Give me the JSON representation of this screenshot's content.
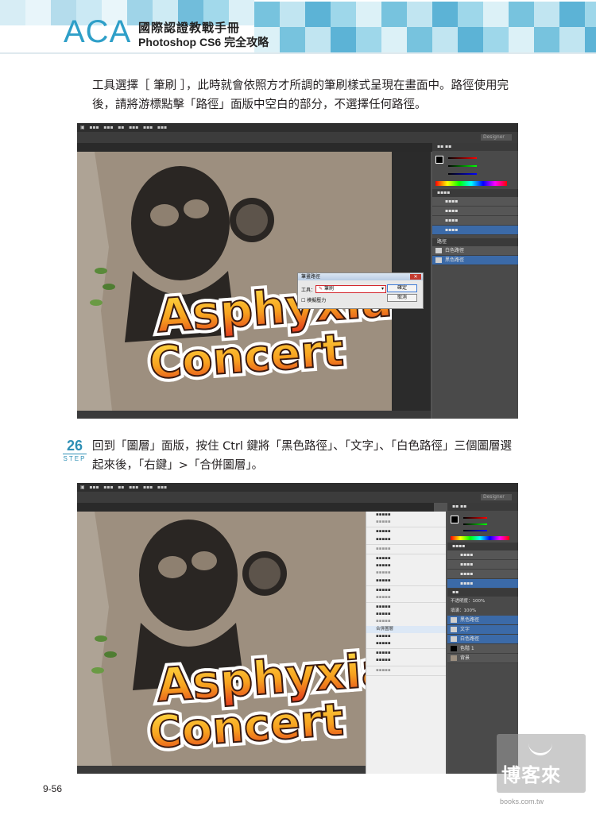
{
  "header": {
    "brand": "ACA",
    "title_line1": "國際認證教戰手冊",
    "title_line2": "Photoshop CS6 完全攻略",
    "tile_colors": [
      "#5fb8d8",
      "#8dd0e6",
      "#b6e1ef",
      "#d6eef6",
      "#3fa6cf"
    ]
  },
  "paragraph1": {
    "line1": "工具選擇［ 筆刷 ］，此時就會依照方才所調的筆刷樣式呈現在畫面中。路徑使用完",
    "line2": "後，請將游標點擊「路徑」面版中空白的部分，不選擇任何路徑。"
  },
  "step": {
    "number": "26",
    "word": "STEP",
    "line1": "回到「圖層」面版，按住 Ctrl 鍵將「黑色路徑」、「文字」、「白色路徑」三個圖層選",
    "line2": "起來後，「右鍵」>「合併圖層」。"
  },
  "screenshot1": {
    "workspace_label": "Designer",
    "paths_panel_tab": "路徑",
    "paths": [
      "路徑 1",
      "白色路徑",
      "黑色路徑"
    ],
    "dialog": {
      "title": "筆畫路徑",
      "tool_label": "工具：",
      "tool_value": "筆刷",
      "ok": "確定",
      "cancel": "取消",
      "simulate": "模擬壓力"
    }
  },
  "screenshot2": {
    "workspace_label": "Designer",
    "opacity": "不透明度：100%",
    "fill": "填滿：100%",
    "layers": [
      "黑色路徑",
      "文字",
      "白色路徑",
      "色階 1",
      "背景"
    ],
    "context_menu_highlight": "合併圖層"
  },
  "artwork": {
    "line1": "Asphyxia",
    "line2": "Concert"
  },
  "watermark": {
    "text": "博客來",
    "url": "books.com.tw"
  },
  "page": {
    "number": "9-56"
  }
}
